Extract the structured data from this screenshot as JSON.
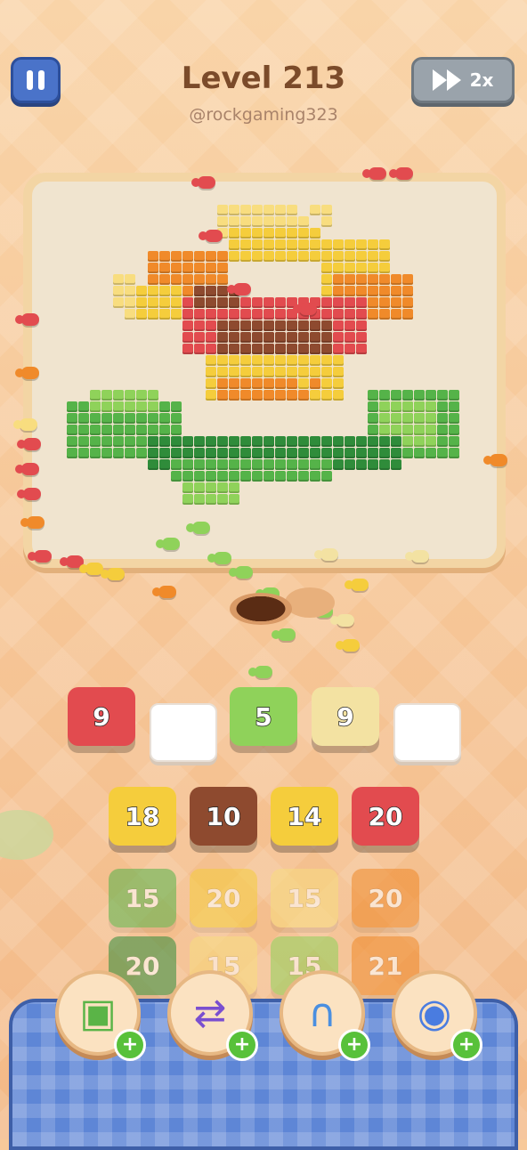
{
  "header": {
    "level_title": "Level 213",
    "watermark": "@rockgaming323",
    "speed_label": "2x"
  },
  "icons": {
    "pause": "pause-icon",
    "fast_forward": "fast-forward-icon"
  },
  "colors": {
    "red": "#e24b4f",
    "brown": "#8e4a2f",
    "yellow": "#f5cd3c",
    "light_yellow": "#f8dd7f",
    "green": "#55b349",
    "dark_green": "#2f8c3a",
    "orange": "#f08a2a",
    "light_green": "#8fd25a",
    "pale_yellow": "#f3e2a2"
  },
  "queue": [
    {
      "value": "9",
      "color": "red"
    },
    {
      "value": "",
      "color": "empty"
    },
    {
      "value": "5",
      "color": "light_green"
    },
    {
      "value": "9",
      "color": "pale_yellow"
    },
    {
      "value": "",
      "color": "empty"
    }
  ],
  "grid": [
    [
      {
        "value": "18",
        "color": "yellow"
      },
      {
        "value": "10",
        "color": "brown"
      },
      {
        "value": "14",
        "color": "yellow"
      },
      {
        "value": "20",
        "color": "red"
      }
    ],
    [
      {
        "value": "15",
        "color": "green"
      },
      {
        "value": "20",
        "color": "yellow"
      },
      {
        "value": "15",
        "color": "light_yellow"
      },
      {
        "value": "20",
        "color": "orange"
      }
    ],
    [
      {
        "value": "20",
        "color": "dark_green"
      },
      {
        "value": "15",
        "color": "light_yellow"
      },
      {
        "value": "15",
        "color": "light_green"
      },
      {
        "value": "21",
        "color": "orange"
      }
    ]
  ],
  "boosters": [
    {
      "name": "add-slot-icon"
    },
    {
      "name": "shuffle-icon"
    },
    {
      "name": "magnet-icon"
    },
    {
      "name": "swap-icon"
    }
  ]
}
